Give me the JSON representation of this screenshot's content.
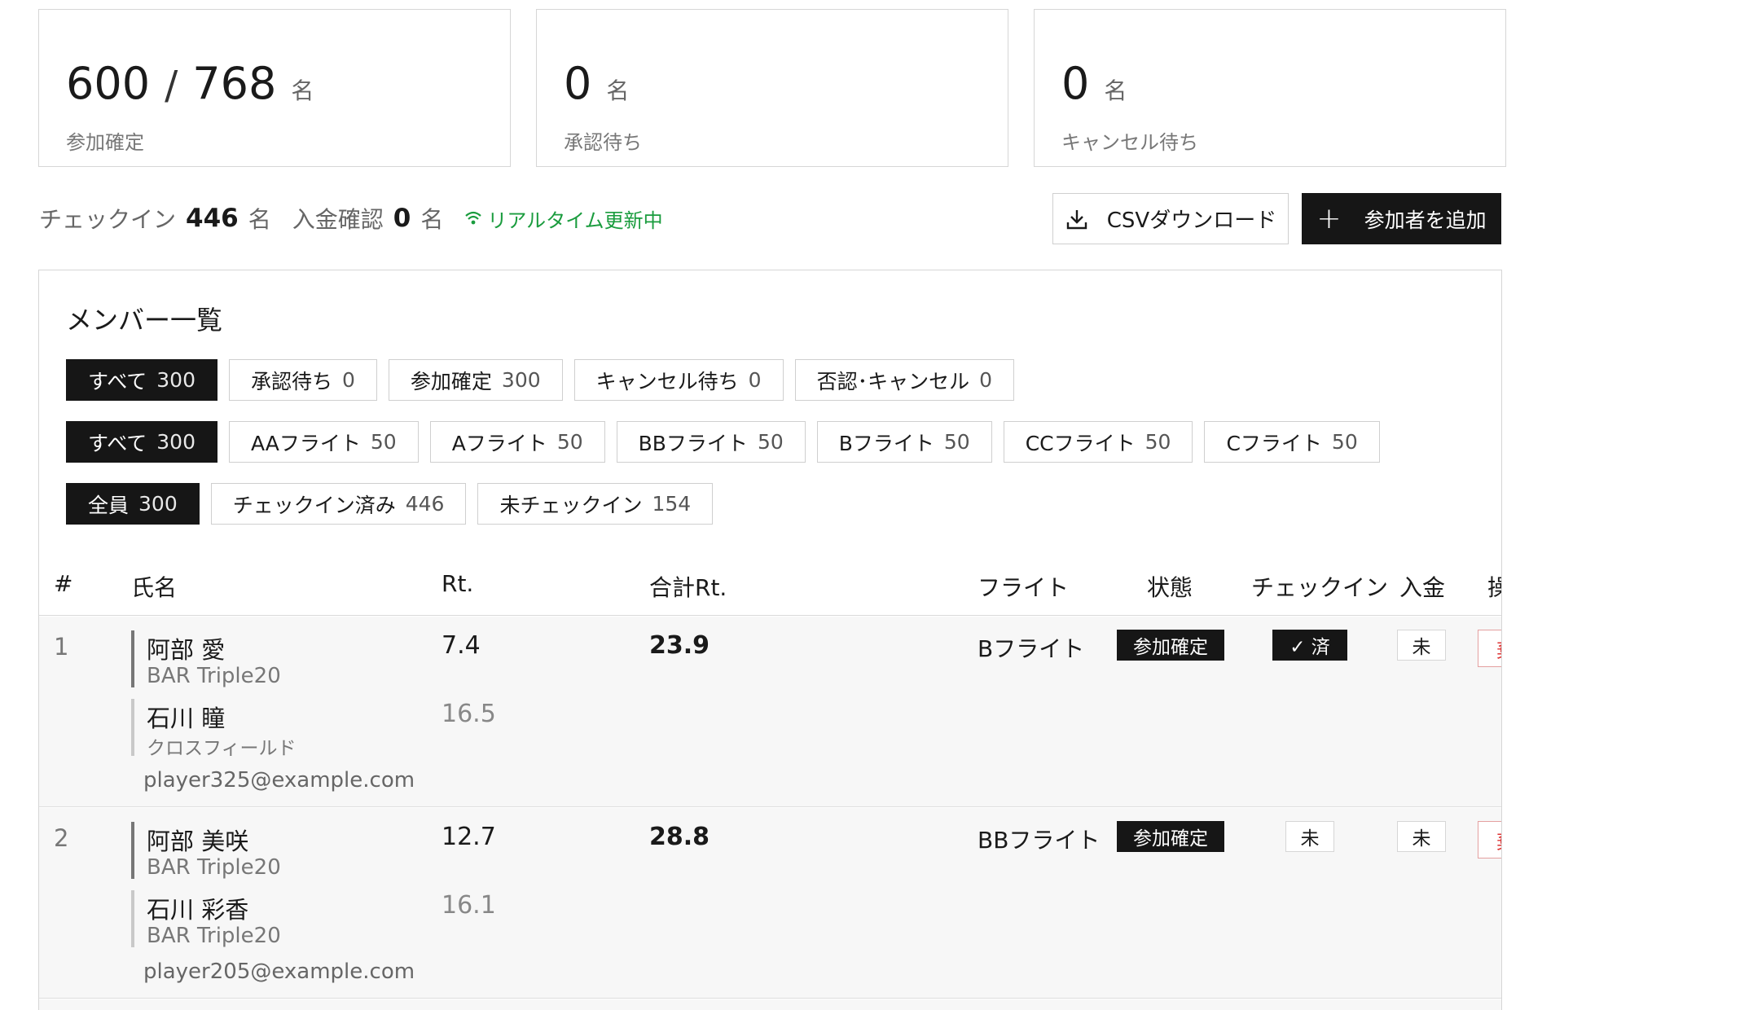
{
  "stats": {
    "confirmed": {
      "value": "600",
      "total": "768",
      "unit": "名",
      "label": "参加確定"
    },
    "pending": {
      "value": "0",
      "unit": "名",
      "label": "承認待ち"
    },
    "cancel_wait": {
      "value": "0",
      "unit": "名",
      "label": "キャンセル待ち"
    }
  },
  "info": {
    "checkin_label": "チェックイン",
    "checkin_value": "446",
    "checkin_unit": "名",
    "payment_label": "入金確認",
    "payment_value": "0",
    "payment_unit": "名",
    "live_label": "リアルタイム更新中"
  },
  "actions": {
    "csv_label": "CSVダウンロード",
    "add_label": "参加者を追加"
  },
  "panel": {
    "title": "メンバー一覧"
  },
  "filters": {
    "status": [
      {
        "label": "すべて",
        "count": "300"
      },
      {
        "label": "承認待ち",
        "count": "0"
      },
      {
        "label": "参加確定",
        "count": "300"
      },
      {
        "label": "キャンセル待ち",
        "count": "0"
      },
      {
        "label": "否認･キャンセル",
        "count": "0"
      }
    ],
    "flight": [
      {
        "label": "すべて",
        "count": "300"
      },
      {
        "label": "AAフライト",
        "count": "50"
      },
      {
        "label": "Aフライト",
        "count": "50"
      },
      {
        "label": "BBフライト",
        "count": "50"
      },
      {
        "label": "Bフライト",
        "count": "50"
      },
      {
        "label": "CCフライト",
        "count": "50"
      },
      {
        "label": "Cフライト",
        "count": "50"
      }
    ],
    "checkin": [
      {
        "label": "全員",
        "count": "300"
      },
      {
        "label": "チェックイン済み",
        "count": "446"
      },
      {
        "label": "未チェックイン",
        "count": "154"
      }
    ]
  },
  "table": {
    "headers": {
      "idx": "#",
      "name": "氏名",
      "rt": "Rt.",
      "total": "合計Rt.",
      "flight": "フライト",
      "status": "状態",
      "checkin": "チェックイン",
      "payment": "入金",
      "action": "操"
    },
    "rows": [
      {
        "idx": "1",
        "p1_name": "阿部 愛",
        "p1_club": "BAR Triple20",
        "p1_rt": "7.4",
        "p2_name": "石川 瞳",
        "p2_club": "クロスフィールド",
        "p2_rt": "16.5",
        "email": "player325@example.com",
        "total": "23.9",
        "flight": "Bフライト",
        "status": "参加確定",
        "checkin": "✓ 済",
        "payment": "未",
        "action": "棄"
      },
      {
        "idx": "2",
        "p1_name": "阿部 美咲",
        "p1_club": "BAR Triple20",
        "p1_rt": "12.7",
        "p2_name": "石川 彩香",
        "p2_club": "BAR Triple20",
        "p2_rt": "16.1",
        "email": "player205@example.com",
        "total": "28.8",
        "flight": "BBフライト",
        "status": "参加確定",
        "checkin": "未",
        "payment": "未",
        "action": "棄"
      }
    ]
  }
}
